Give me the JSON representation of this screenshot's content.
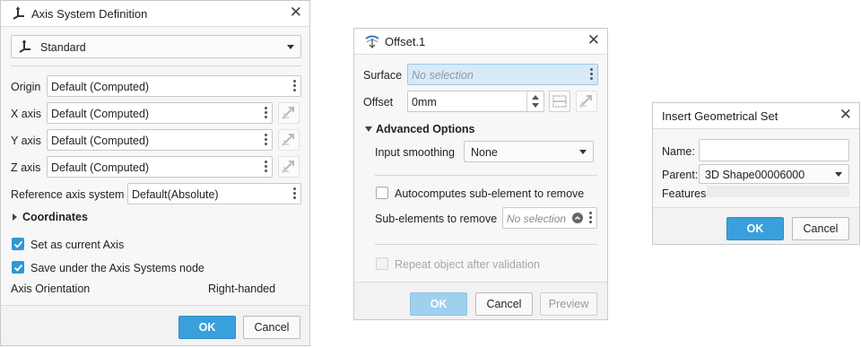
{
  "axis_dialog": {
    "title": "Axis System Definition",
    "type_value": "Standard",
    "rows": [
      {
        "label": "Origin",
        "value": "Default (Computed)"
      },
      {
        "label": "X axis",
        "value": "Default (Computed)"
      },
      {
        "label": "Y axis",
        "value": "Default (Computed)"
      },
      {
        "label": "Z axis",
        "value": "Default (Computed)"
      }
    ],
    "ref_label": "Reference axis system",
    "ref_value": "Default(Absolute)",
    "coordinates_label": "Coordinates",
    "set_current_label": "Set as current Axis",
    "save_under_label": "Save under the Axis Systems node",
    "orientation_label": "Axis Orientation",
    "orientation_value": "Right-handed",
    "ok": "OK",
    "cancel": "Cancel"
  },
  "offset_dialog": {
    "title": "Offset.1",
    "surface_label": "Surface",
    "surface_placeholder": "No selection",
    "offset_label": "Offset",
    "offset_value": "0mm",
    "advanced_label": "Advanced Options",
    "smoothing_label": "Input smoothing",
    "smoothing_value": "None",
    "autocompute_label": "Autocomputes sub-element to remove",
    "subelements_label": "Sub-elements to remove",
    "subelements_placeholder": "No selection",
    "repeat_label": "Repeat object after validation",
    "ok": "OK",
    "cancel": "Cancel",
    "preview": "Preview"
  },
  "geoset_dialog": {
    "title": "Insert Geometrical Set",
    "name_label": "Name:",
    "name_value": "",
    "parent_label": "Parent:",
    "parent_value": "3D Shape00006000",
    "features_label": "Features:",
    "ok": "OK",
    "cancel": "Cancel"
  },
  "colors": {
    "accent": "#3aa0dc",
    "checkbox_checked": "#2f97d6",
    "selected_field": "#d6eaf8"
  }
}
